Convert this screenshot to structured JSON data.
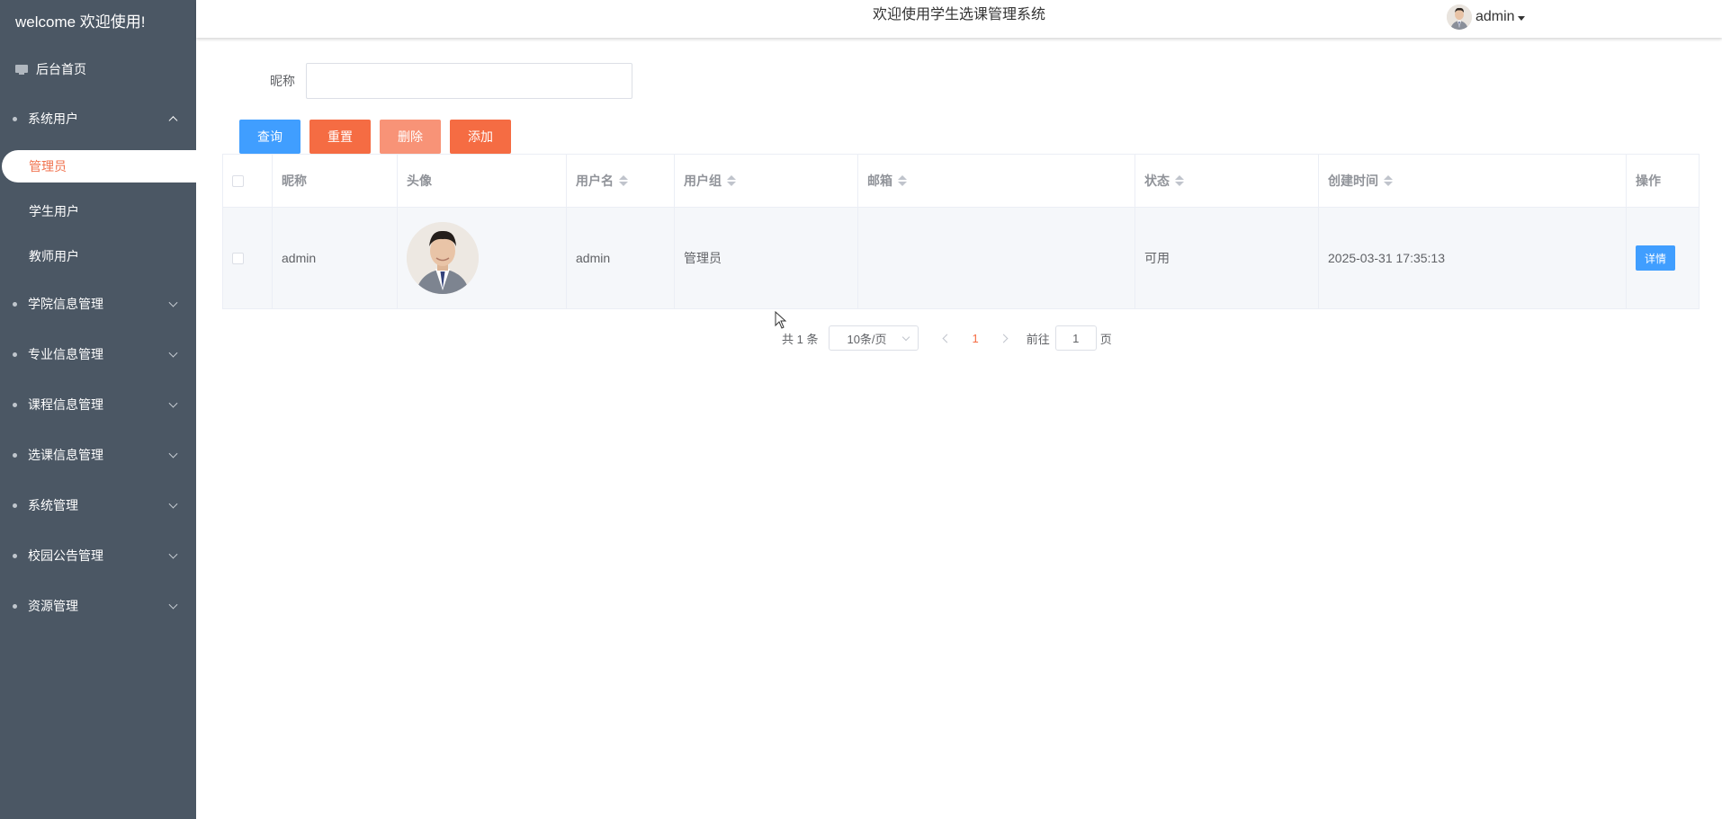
{
  "sidebar": {
    "brand": "welcome 欢迎使用!",
    "home": "后台首页",
    "group_system_users": "系统用户",
    "sub_items": [
      "管理员",
      "学生用户",
      "教师用户"
    ],
    "menu": [
      "学院信息管理",
      "专业信息管理",
      "课程信息管理",
      "选课信息管理",
      "系统管理",
      "校园公告管理",
      "资源管理"
    ]
  },
  "header": {
    "title": "欢迎使用学生选课管理系统",
    "username": "admin"
  },
  "search": {
    "label": "昵称",
    "value": ""
  },
  "buttons": {
    "query": "查询",
    "reset": "重置",
    "delete": "删除",
    "add": "添加"
  },
  "table": {
    "columns": [
      "昵称",
      "头像",
      "用户名",
      "用户组",
      "邮箱",
      "状态",
      "创建时间",
      "操作"
    ],
    "rows": [
      {
        "nickname": "admin",
        "username": "admin",
        "group": "管理员",
        "email": "",
        "status": "可用",
        "created": "2025-03-31 17:35:13",
        "action": "详情"
      }
    ]
  },
  "pagination": {
    "total": "共 1 条",
    "page_size": "10条/页",
    "current_page": "1",
    "goto_label": "前往",
    "goto_value": "1",
    "page_suffix": "页"
  },
  "colors": {
    "sidebar_bg": "#4b5764",
    "primary": "#409eff",
    "accent": "#f56c43"
  }
}
